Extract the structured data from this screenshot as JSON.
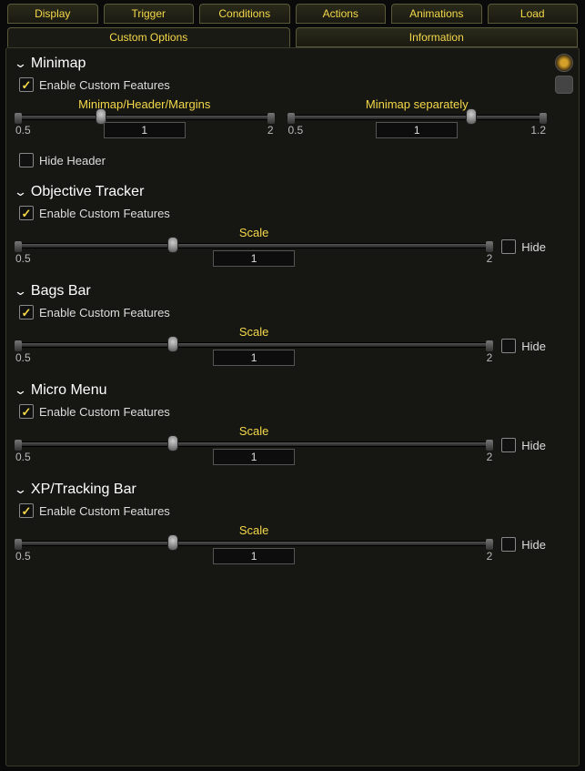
{
  "tabs": {
    "primary": [
      "Display",
      "Trigger",
      "Conditions",
      "Actions",
      "Animations",
      "Load"
    ],
    "secondary": [
      "Custom Options",
      "Information"
    ],
    "active_secondary": 0
  },
  "common": {
    "enable_label": "Enable Custom Features",
    "hide_label": "Hide",
    "scale_label": "Scale",
    "min05": "0.5",
    "max2": "2",
    "max12": "1.2",
    "val1": "1"
  },
  "sections": {
    "minimap": {
      "title": "Minimap",
      "enabled": true,
      "slider1_label": "Minimap/Header/Margins",
      "slider2_label": "Minimap separately",
      "hide_header_label": "Hide Header",
      "hide_header_checked": false
    },
    "objective": {
      "title": "Objective Tracker",
      "enabled": true,
      "hide_checked": false
    },
    "bags": {
      "title": "Bags Bar",
      "enabled": true,
      "hide_checked": false
    },
    "micro": {
      "title": "Micro Menu",
      "enabled": true,
      "hide_checked": false
    },
    "xp": {
      "title": "XP/Tracking Bar",
      "enabled": true,
      "hide_checked": false
    }
  }
}
